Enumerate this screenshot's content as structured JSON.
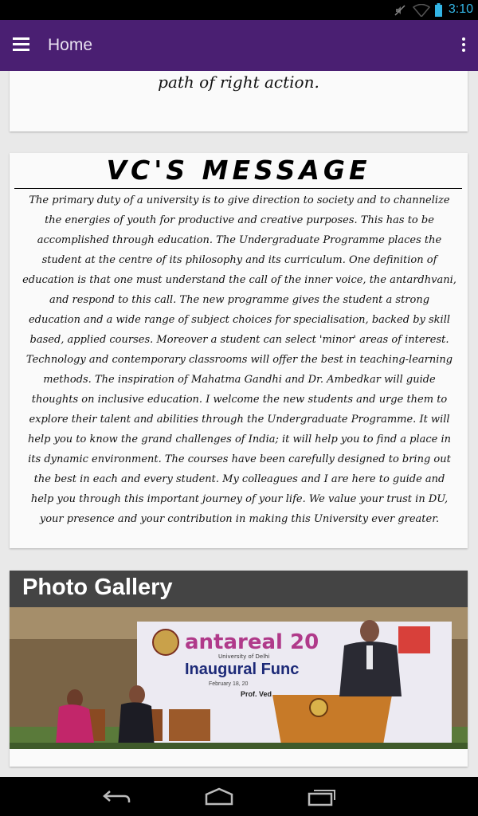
{
  "status_bar": {
    "time": "3:10",
    "icons": [
      "mute-icon",
      "wifi-icon",
      "battery-icon"
    ]
  },
  "app_bar": {
    "title": "Home",
    "menu_icon": "hamburger-menu-icon",
    "overflow_icon": "more-vert-icon",
    "color": "#4a1f72"
  },
  "quote_card": {
    "tail_text": "path of right action."
  },
  "vc_card": {
    "title": "VC'S MESSAGE",
    "body": "The primary duty of a university is to give direction to society and to channelize the energies of youth for productive and creative purposes. This has to be accomplished through education. The Undergraduate Programme places the student at the centre of its philosophy and its curriculum. One definition of education is that one must understand the call of the inner voice, the antardhvani, and respond to this call. The new programme gives the student a strong education and a wide range of subject choices for specialisation, backed by skill based, applied courses. Moreover a student can select 'minor' areas of interest. Technology and contemporary classrooms will offer the best in teaching-learning methods. The inspiration of Mahatma Gandhi and Dr. Ambedkar will guide thoughts on inclusive education. I welcome the new students and urge them to explore their talent and abilities through the Undergraduate Programme. It will help you to know the grand challenges of India; it will help you to find a place in its dynamic environment. The courses have been carefully designed to bring out the best in each and every student. My colleagues and I are here to guide and help you through this important journey of your life. We value your trust in DU, your presence and your contribution in making this University ever greater."
  },
  "gallery_card": {
    "title": "Photo Gallery",
    "photo": {
      "banner_brand": "antareal 20",
      "banner_sub": "University of Delhi",
      "banner_heading": "Inaugural Func",
      "banner_date": "February 18, 20",
      "banner_name": "Prof. Ved"
    }
  },
  "nav_bar": {
    "icons": [
      "back-icon",
      "home-icon",
      "recent-apps-icon"
    ]
  }
}
